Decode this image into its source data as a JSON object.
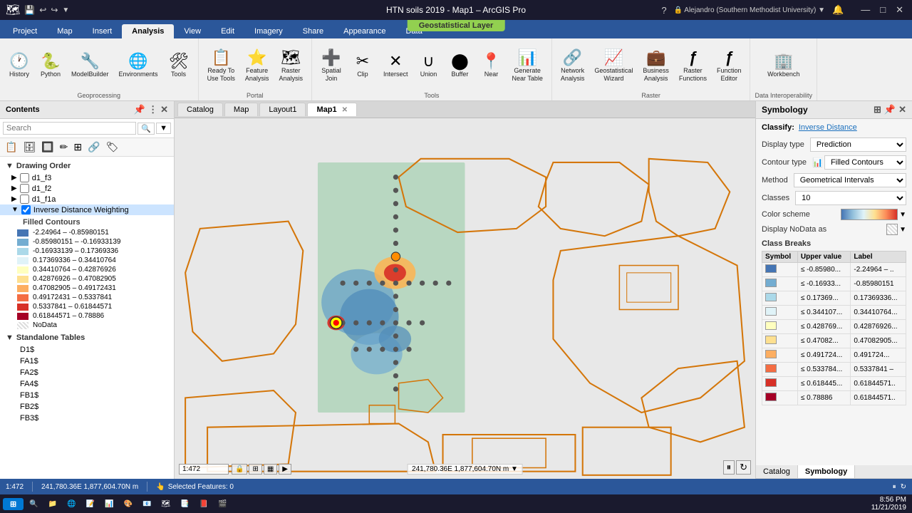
{
  "titlebar": {
    "title": "HTN soils 2019 - Map1 – ArcGIS Pro",
    "geo_banner": "Geostatistical Layer"
  },
  "ribbon": {
    "tabs": [
      "Project",
      "Map",
      "Insert",
      "Analysis",
      "View",
      "Edit",
      "Imagery",
      "Share",
      "Appearance",
      "Data"
    ],
    "active_tab": "Analysis",
    "groups": [
      {
        "label": "Geoprocessing",
        "items": [
          {
            "icon": "⟳",
            "label": "History"
          },
          {
            "icon": "🐍",
            "label": "Python"
          },
          {
            "icon": "🔧",
            "label": "ModelBuilder"
          },
          {
            "icon": "🌐",
            "label": "Environments"
          },
          {
            "icon": "🔨",
            "label": "Tools"
          }
        ]
      },
      {
        "label": "Portal",
        "items": [
          {
            "icon": "📋",
            "label": "Ready To\nUse Tools"
          },
          {
            "icon": "⭐",
            "label": "Feature\nAnalysis"
          },
          {
            "icon": "🗺",
            "label": "Raster\nAnalysis"
          }
        ]
      },
      {
        "label": "Tools",
        "items": [
          {
            "icon": "➕",
            "label": "Spatial\nJoin"
          },
          {
            "icon": "✂",
            "label": "Clip"
          },
          {
            "icon": "✕",
            "label": "Intersect"
          },
          {
            "icon": "∪",
            "label": "Union"
          },
          {
            "icon": "⬤",
            "label": "Buffer"
          },
          {
            "icon": "📍",
            "label": "Near"
          },
          {
            "icon": "📊",
            "label": "Generate\nNear Table"
          }
        ]
      },
      {
        "label": "Raster",
        "items": [
          {
            "icon": "🔗",
            "label": "Network\nAnalysis"
          },
          {
            "icon": "📈",
            "label": "Geostatistical\nWizard"
          },
          {
            "icon": "💼",
            "label": "Business\nAnalysis"
          },
          {
            "icon": "ƒ",
            "label": "Raster\nFunctions"
          },
          {
            "icon": "ƒ",
            "label": "Function\nEditor"
          }
        ]
      },
      {
        "label": "Data Interoperability",
        "items": [
          {
            "icon": "🏢",
            "label": "Workbench"
          }
        ]
      }
    ]
  },
  "contents": {
    "title": "Contents",
    "search_placeholder": "Search",
    "drawing_order": "Drawing Order",
    "layers": [
      {
        "id": "d1_f3",
        "label": "d1_f3",
        "checked": false,
        "selected": false
      },
      {
        "id": "d1_f2",
        "label": "d1_f2",
        "checked": false,
        "selected": false
      },
      {
        "id": "d1_f1a",
        "label": "d1_f1a",
        "checked": false,
        "selected": false
      },
      {
        "id": "idw",
        "label": "Inverse Distance Weighting",
        "checked": true,
        "selected": true
      }
    ],
    "filled_contours": {
      "label": "Filled Contours",
      "classes": [
        {
          "color": "#4575b4",
          "range": "-2.24964 – -0.85980151"
        },
        {
          "color": "#74add1",
          "range": "-0.85980151 – -0.16933139"
        },
        {
          "color": "#abd9e9",
          "range": "-0.16933139 – 0.17369336"
        },
        {
          "color": "#e0f3f8",
          "range": "0.17369336 – 0.34410764"
        },
        {
          "color": "#ffffbf",
          "range": "0.34410764 – 0.42876926"
        },
        {
          "color": "#fee090",
          "range": "0.42876926 – 0.47082905"
        },
        {
          "color": "#fdae61",
          "range": "0.47082905 – 0.49172431"
        },
        {
          "color": "#f46d43",
          "range": "0.49172431 – 0.5337841"
        },
        {
          "color": "#d73027",
          "range": "0.5337841 – 0.61844571"
        },
        {
          "color": "#a50026",
          "range": "0.61844571 – 0.78886"
        },
        {
          "color": null,
          "range": "NoData"
        }
      ]
    },
    "standalone_tables_label": "Standalone Tables",
    "standalone_tables": [
      "D1$",
      "FA1$",
      "FA2$",
      "FA4$",
      "FB1$",
      "FB2$",
      "FB3$"
    ]
  },
  "map_tabs": [
    {
      "label": "Catalog",
      "active": false
    },
    {
      "label": "Map",
      "active": false
    },
    {
      "label": "Layout1",
      "active": false
    },
    {
      "label": "Map1",
      "active": true,
      "closable": true
    }
  ],
  "symbology": {
    "title": "Symbology",
    "classify_label": "Classify:",
    "classify_value": "Inverse Distance",
    "display_type_label": "Display type",
    "display_type_value": "Prediction",
    "contour_type_label": "Contour type",
    "contour_type_value": "Filled Contours",
    "method_label": "Method",
    "method_value": "Geometrical Intervals",
    "classes_label": "Classes",
    "classes_value": "10",
    "color_scheme_label": "Color scheme",
    "display_nodata_label": "Display NoData as",
    "class_breaks_header": "Class Breaks",
    "col_symbol": "Symbol",
    "col_upper": "Upper value",
    "col_label": "Label",
    "breaks": [
      {
        "color": "#4575b4",
        "upper": "≤ -0.85980...",
        "label": "-2.24964 – .."
      },
      {
        "color": "#74add1",
        "upper": "≤ -0.16933...",
        "label": "-0.85980151"
      },
      {
        "color": "#abd9e9",
        "upper": "≤ 0.17369...",
        "label": "0.17369336..."
      },
      {
        "color": "#e0f3f8",
        "upper": "≤ 0.344107...",
        "label": "0.34410764..."
      },
      {
        "color": "#ffffbf",
        "upper": "≤ 0.428769...",
        "label": "0.42876926..."
      },
      {
        "color": "#fee090",
        "upper": "≤ 0.47082...",
        "label": "0.47082905..."
      },
      {
        "color": "#fdae61",
        "upper": "≤ 0.491724...",
        "label": "0.491724..."
      },
      {
        "color": "#f46d43",
        "upper": "≤ 0.533784...",
        "label": "0.5337841 –"
      },
      {
        "color": "#d73027",
        "upper": "≤ 0.618445...",
        "label": "0.61844571.."
      },
      {
        "color": "#a50026",
        "upper": "≤ 0.78886",
        "label": "0.61844571.."
      }
    ]
  },
  "panel_tabs": [
    "Catalog",
    "Symbology"
  ],
  "active_panel_tab": "Symbology",
  "status_bar": {
    "scale": "1:472",
    "coords": "241,780.36E 1,877,604.70N m",
    "selected": "Selected Features: 0"
  },
  "taskbar": {
    "start": "⊞",
    "apps": [
      "🔍",
      "📁",
      "🌐",
      "📝",
      "📊",
      "🎨",
      "📧",
      "🔔",
      "📱",
      "🎵",
      "🎬",
      "💻"
    ],
    "time": "8:56 PM",
    "date": "11/21/2019"
  }
}
